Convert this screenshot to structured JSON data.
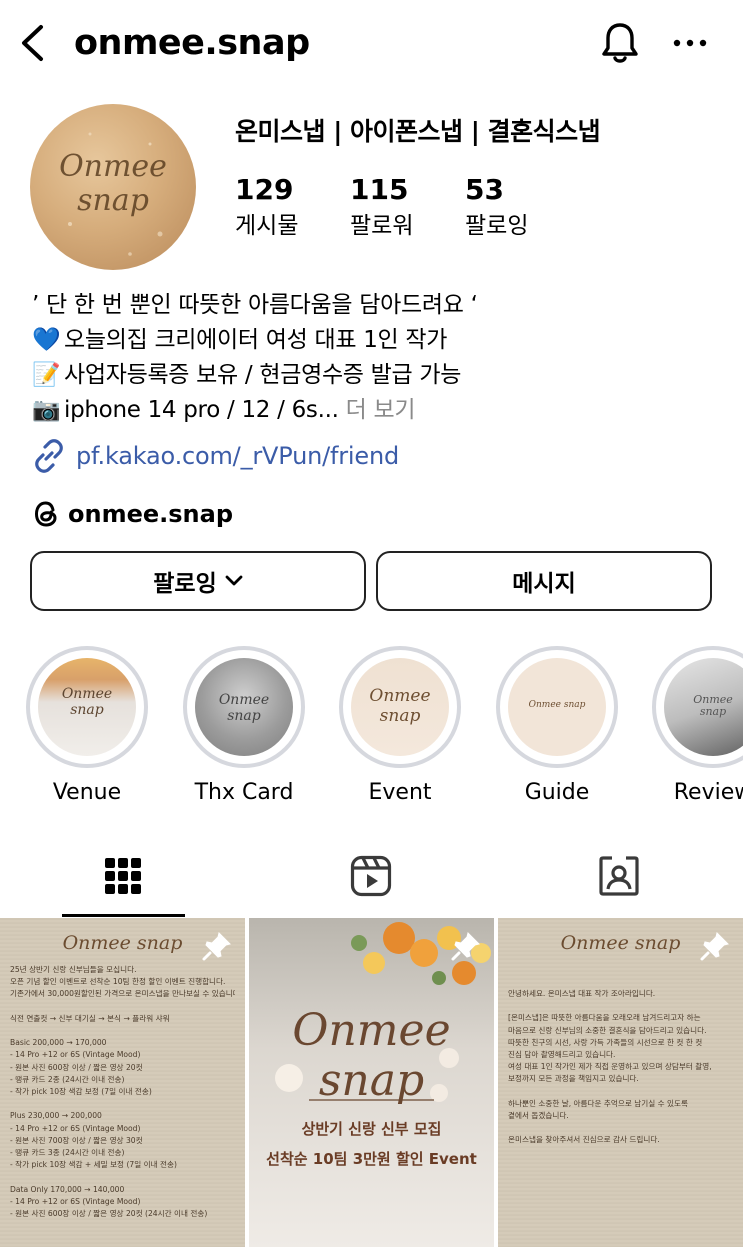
{
  "header": {
    "username": "onmee.snap"
  },
  "profile": {
    "avatar_text": "Onmee snap",
    "display_name": "온미스냅 | 아이폰스냅 | 결혼식스냅",
    "stats": [
      {
        "count": "129",
        "label": "게시물"
      },
      {
        "count": "115",
        "label": "팔로워"
      },
      {
        "count": "53",
        "label": "팔로잉"
      }
    ],
    "bio": {
      "line1": "’ 단 한 번 뿐인 따뜻한 아름다움을 담아드려요 ‘",
      "line2_emoji": "💙",
      "line2": "오늘의집 크리에이터 여성 대표 1인 작가",
      "line3_emoji": "📝",
      "line3": "사업자등록증 보유 / 현금영수증 발급 가능",
      "line4_emoji": "📷",
      "line4": "iphone 14 pro / 12 / 6s...",
      "more": " 더 보기"
    },
    "link": "pf.kakao.com/_rVPun/friend",
    "threads": "onmee.snap"
  },
  "actions": {
    "follow_label": "팔로잉",
    "message_label": "메시지"
  },
  "highlights": [
    {
      "label": "Venue",
      "cover_text": "Onmee snap"
    },
    {
      "label": "Thx Card",
      "cover_text": "Onmee snap"
    },
    {
      "label": "Event",
      "cover_text": "Onmee snap"
    },
    {
      "label": "Guide",
      "cover_text": "Onmee snap"
    },
    {
      "label": "Review",
      "cover_text": "Onmee snap"
    }
  ],
  "tabs": [
    "grid-icon",
    "reels-icon",
    "tagged-icon"
  ],
  "posts": {
    "p1": {
      "title": "Onmee snap",
      "lines": [
        "25년 상반기 신랑 신부님들을 모십니다.",
        "오픈 기념 할인 이벤트로 선착순 10팀 한정 할인 이벤트 진행합니다.",
        "기존가에서 30,000원할인된 가격으로 온미스냅을 만나보실 수 있습니다.",
        "",
        "식전 연출컷 → 신부 대기실 → 본식 → 플라워 샤워",
        "",
        "Basic 200,000 → 170,000",
        "- 14 Pro +12 or 6S (Vintage Mood)",
        "- 원본 사진 600장 이상 / 짧은 영상 20컷",
        "- 땡큐 카드 2종 (24시간 이내 전송)",
        "- 작가 pick 10장 색감 보정 (7일 이내 전송)",
        "",
        "Plus 230,000 → 200,000",
        "- 14 Pro +12 or 6S (Vintage Mood)",
        "- 원본 사진 700장 이상 / 짧은 영상 30컷",
        "- 땡큐 카드 3종 (24시간 이내 전송)",
        "- 작가 pick 10장 색감 + 세밀 보정 (7일 이내 전송)",
        "",
        "Data Only 170,000 → 140,000",
        "- 14 Pro +12 or 6S (Vintage Mood)",
        "- 원본 사진 600장 이상 / 짧은 영상 20컷 (24시간 이내 전송)"
      ]
    },
    "p2": {
      "title_line1": "Onmee",
      "title_line2": "snap",
      "sub1": "상반기 신랑 신부 모집",
      "sub2": "선착순 10팀 3만원 할인 Event"
    },
    "p3": {
      "title": "Onmee snap",
      "lines": [
        "안녕하세요. 온미스냅 대표 작가 조아라입니다.",
        "",
        "[온미스냅]은 따뜻한 아름다움을 오래오래 남겨드리고자 하는",
        "마음으로 신랑 신부님의 소중한 결혼식을 담아드리고 있습니다.",
        "따뜻한 친구의 시선, 사랑 가득 가족들의 시선으로 한 컷 한 컷",
        "진심 담아 촬영해드리고 있습니다.",
        "여성 대표 1인 작가인 제가 직접 운영하고 있으며 상담부터 촬영,",
        "보정까지 모든 과정을 책임지고 있습니다.",
        "",
        "하나뿐인 소중한 날, 아름다운 추억으로 남기실 수 있도록",
        "곁에서 돕겠습니다.",
        "",
        "온미스냅을 찾아주셔서 진심으로 감사 드립니다."
      ]
    }
  },
  "colors": {
    "link": "#3b5ca8",
    "ring": "#d6d8de",
    "muted": "#8a8a8a"
  }
}
